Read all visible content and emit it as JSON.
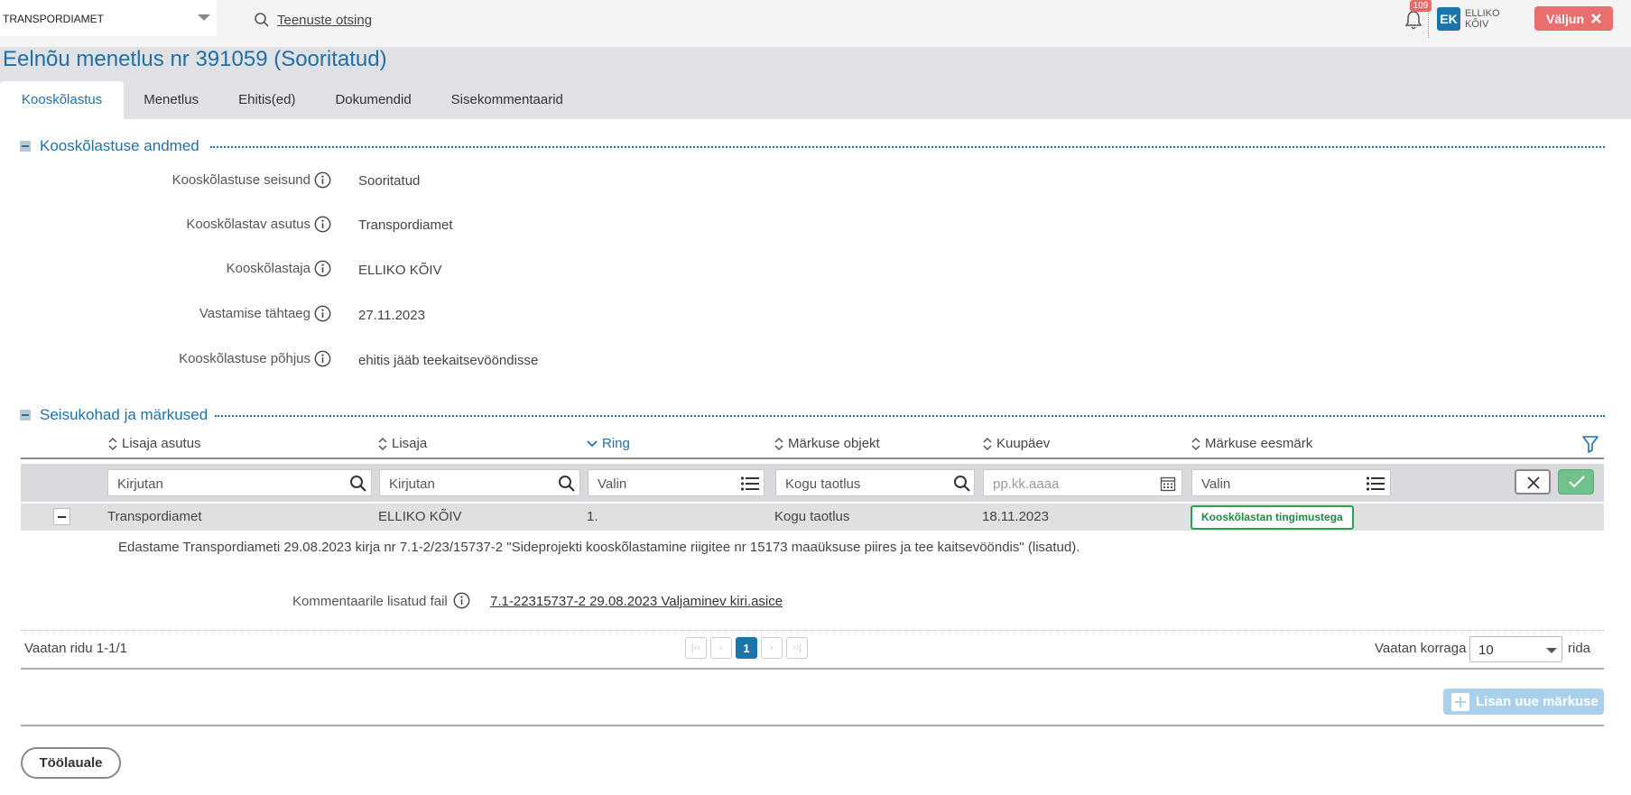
{
  "header": {
    "organization": "TRANSPORDIAMET",
    "search_label": "Teenuste otsing",
    "notifications_count": "109",
    "user_initials": "EK",
    "user_first": "ELLIKO",
    "user_last": "KÕIV",
    "logout_label": "Väljun"
  },
  "page_title": "Eelnõu menetlus nr 391059 (Sooritatud)",
  "tabs": [
    "Kooskõlastus",
    "Menetlus",
    "Ehitis(ed)",
    "Dokumendid",
    "Sisekommentaarid"
  ],
  "details_section": {
    "title": "Kooskõlastuse andmed",
    "fields": [
      {
        "label": "Kooskõlastuse seisund",
        "value": "Sooritatud"
      },
      {
        "label": "Kooskõlastav asutus",
        "value": "Transpordiamet"
      },
      {
        "label": "Kooskõlastaja",
        "value": "ELLIKO KÕIV"
      },
      {
        "label": "Vastamise tähtaeg",
        "value": "27.11.2023"
      },
      {
        "label": "Kooskõlastuse põhjus",
        "value": "ehitis jääb teekaitsevööndisse"
      }
    ]
  },
  "remarks_section": {
    "title": "Seisukohad ja märkused",
    "columns": [
      "Lisaja asutus",
      "Lisaja",
      "Ring",
      "Märkuse objekt",
      "Kuupäev",
      "Märkuse eesmärk"
    ],
    "filters": [
      "Kirjutan",
      "Kirjutan",
      "Valin",
      "Kogu taotlus",
      "pp.kk.aaaa",
      "Valin"
    ],
    "row": {
      "institution": "Transpordiamet",
      "author": "ELLIKO KÕIV",
      "round": "1.",
      "object": "Kogu taotlus",
      "date": "18.11.2023",
      "purpose": "Kooskõlastan tingimustega"
    },
    "comment": "Edastame Transpordiameti 29.08.2023 kirja nr 7.1-2/23/15737-2 \"Sideprojekti kooskõlastamine riigitee nr 15173 maaüksuse piires ja tee kaitsevööndis\" (lisatud).",
    "attachment_label": "Kommentaarile lisatud fail",
    "attachment_file": "7.1-22315737-2 29.08.2023 Valjaminev kiri.asice",
    "rows_info": "Vaatan ridu 1-1/1",
    "current_page": "1",
    "page_size_label": "Vaatan korraga",
    "page_size": "10",
    "page_size_suffix": "rida",
    "add_button": "Lisan uue märkuse"
  },
  "back_button": "Töölauale"
}
